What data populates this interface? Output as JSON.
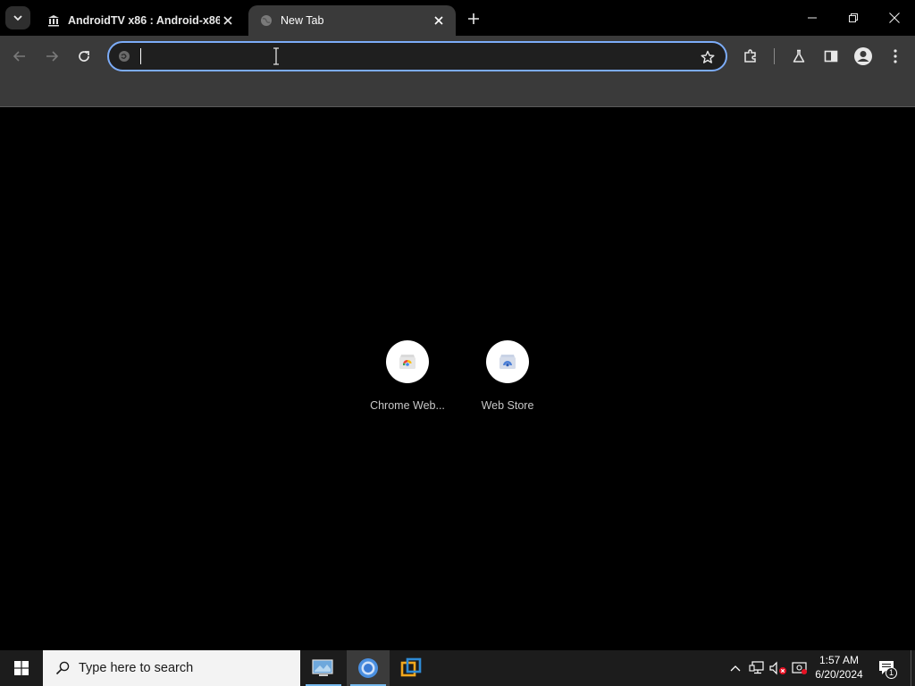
{
  "tabs": [
    {
      "title": "AndroidTV x86 : Android-x86 ..",
      "active": false,
      "icon": "library-icon"
    },
    {
      "title": "New Tab",
      "active": true,
      "icon": "globe-icon"
    }
  ],
  "omnibox": {
    "value": "",
    "placeholder": ""
  },
  "shortcuts": [
    {
      "label": "Chrome Web...",
      "icon": "chrome-web-store-icon"
    },
    {
      "label": "Web Store",
      "icon": "web-store-icon"
    }
  ],
  "taskbar": {
    "search_placeholder": "Type here to search",
    "time": "1:57 AM",
    "date": "6/20/2024",
    "notification_count": "1"
  },
  "colors": {
    "toolbar": "#3a3a3a",
    "omnibox_border": "#7cacf8",
    "taskbar": "#1c1c1c",
    "accent": "#76b9ed"
  }
}
